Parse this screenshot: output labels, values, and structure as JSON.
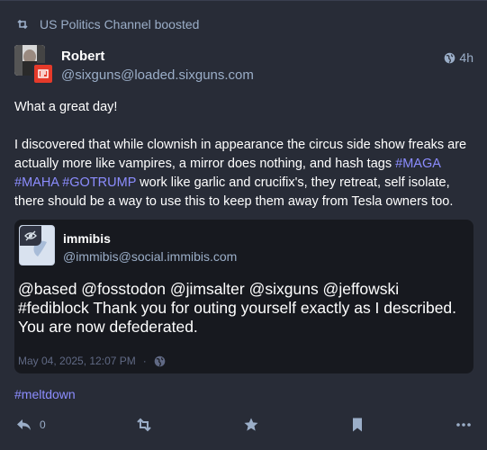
{
  "boost": {
    "text": "US Politics Channel boosted",
    "icon": "boost-icon"
  },
  "status": {
    "display_name": "Robert",
    "handle": "@sixguns@loaded.sixguns.com",
    "time": "4h",
    "visibility_icon": "globe-icon",
    "content": {
      "p1": "What a great day!",
      "p2_part1": "I discovered that while clownish in appearance the circus side show freaks are actually more like vampires, a mirror does nothing, and hash tags ",
      "tag_maga": "#MAGA",
      "tag_maha": "#MAHA",
      "tag_gotrump": "#GOTRUMP",
      "p2_part2": " work like garlic and crucifix's, they retreat, self isolate, there should be a way to use this to keep them away from Tesla owners too."
    },
    "quote": {
      "display_name": "immibis",
      "handle": "@immibis@social.immibis.com",
      "text": "@based @fosstodon @jimsalter @sixguns @jeffowski #fediblock Thank you for outing yourself exactly as I described. You are now defederated.",
      "date": "May 04, 2025, 12:07 PM",
      "separator": "·"
    },
    "hashtag": "#meltdown",
    "actions": {
      "reply_count": "0"
    }
  },
  "colors": {
    "background": "#282c37",
    "accent": "#8c8dff",
    "muted": "#9baec8",
    "quote_bg": "#17191f"
  }
}
